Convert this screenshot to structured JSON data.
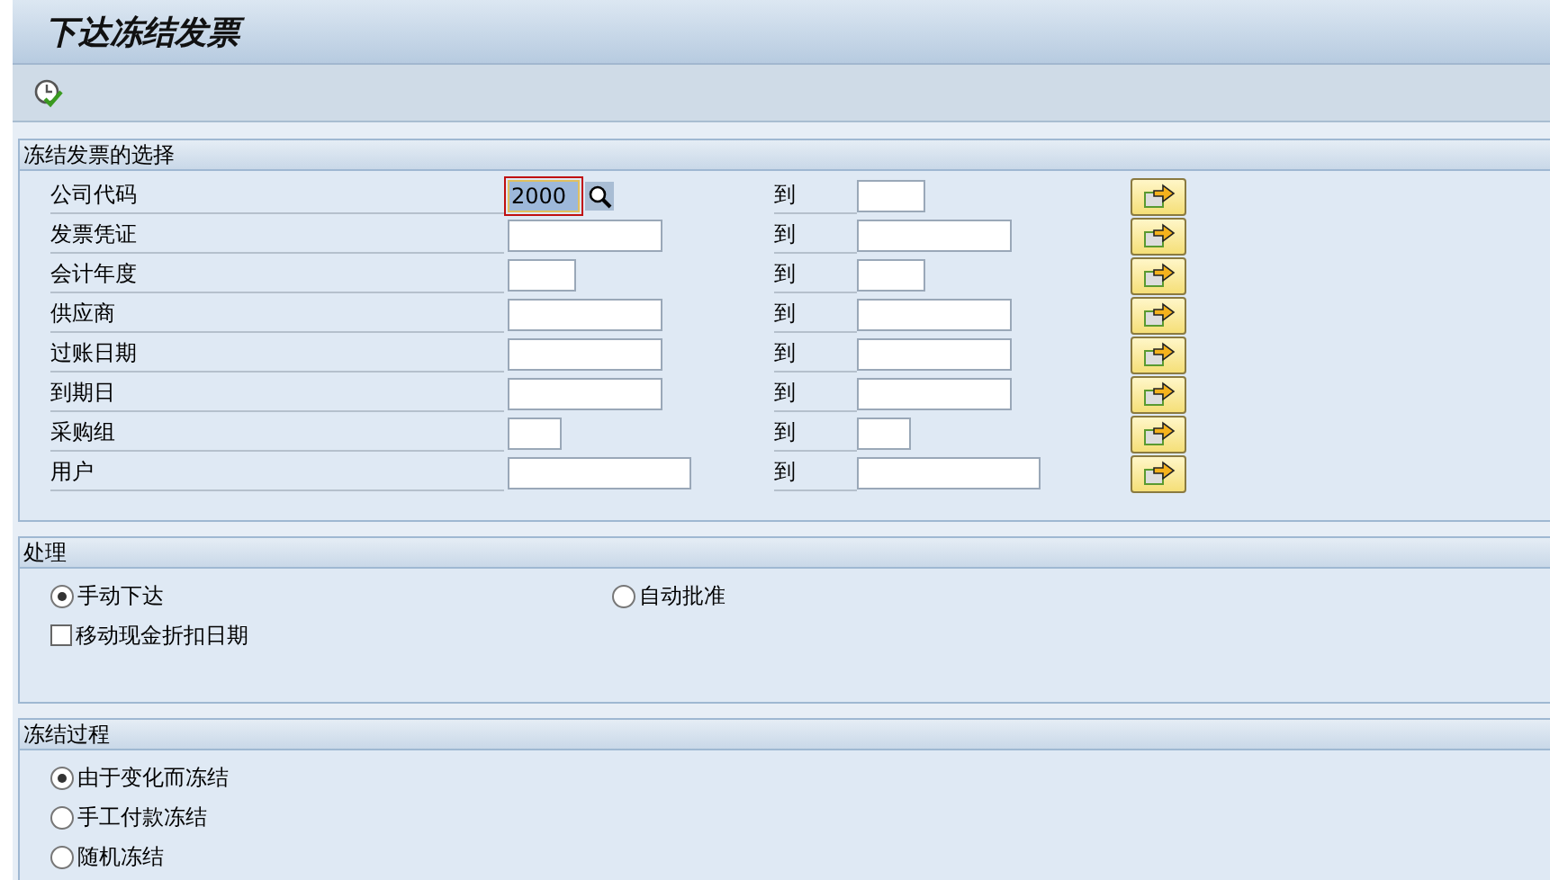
{
  "window": {
    "title": "下达冻结发票"
  },
  "selection": {
    "title": "冻结发票的选择",
    "rows": [
      {
        "label": "公司代码",
        "from": "2000",
        "focused": true,
        "to": "",
        "to_label": "到"
      },
      {
        "label": "发票凭证",
        "from": "",
        "focused": false,
        "to": "",
        "to_label": "到"
      },
      {
        "label": "会计年度",
        "from": "",
        "focused": false,
        "to": "",
        "to_label": "到"
      },
      {
        "label": "供应商",
        "from": "",
        "focused": false,
        "to": "",
        "to_label": "到"
      },
      {
        "label": "过账日期",
        "from": "",
        "focused": false,
        "to": "",
        "to_label": "到"
      },
      {
        "label": "到期日",
        "from": "",
        "focused": false,
        "to": "",
        "to_label": "到"
      },
      {
        "label": "采购组",
        "from": "",
        "focused": false,
        "to": "",
        "to_label": "到"
      },
      {
        "label": "用户",
        "from": "",
        "focused": false,
        "to": "",
        "to_label": "到"
      }
    ]
  },
  "processing": {
    "title": "处理",
    "options": [
      {
        "kind": "radio",
        "label": "手动下达",
        "selected": true
      },
      {
        "kind": "radio",
        "label": "自动批准",
        "selected": false
      },
      {
        "kind": "checkbox",
        "label": "移动现金折扣日期",
        "checked": false
      }
    ]
  },
  "block_process": {
    "title": "冻结过程",
    "options": [
      {
        "kind": "radio",
        "label": "由于变化而冻结",
        "selected": true
      },
      {
        "kind": "radio",
        "label": "手工付款冻结",
        "selected": false
      },
      {
        "kind": "radio",
        "label": "随机冻结",
        "selected": false
      }
    ]
  }
}
